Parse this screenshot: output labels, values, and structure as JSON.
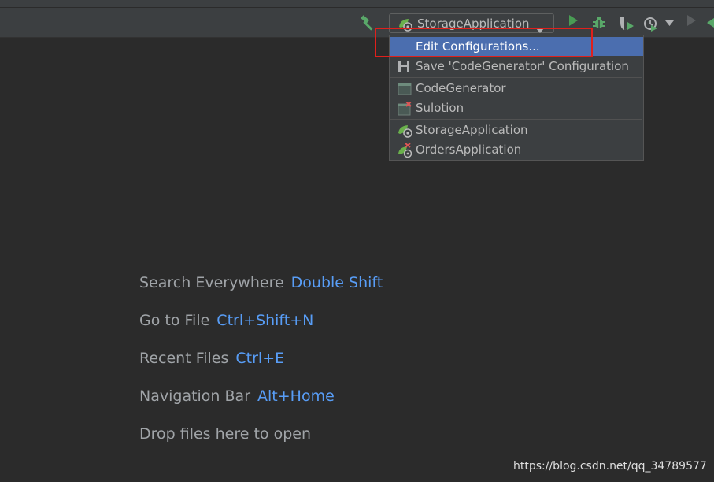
{
  "toolbar": {
    "run_config": {
      "label": "StorageApplication",
      "icon": "spring-boot-icon"
    },
    "icons": [
      "build-hammer-icon",
      "run-icon",
      "debug-bug-icon",
      "coverage-icon",
      "profile-icon",
      "chevron-down-icon",
      "run-disabled-icon"
    ]
  },
  "run_config_menu": {
    "items": [
      {
        "label": "Edit Configurations...",
        "icon": "",
        "selected": true
      },
      {
        "label": "Save 'CodeGenerator' Configuration",
        "icon": "save-icon"
      },
      {
        "label": "CodeGenerator",
        "icon": "application-icon"
      },
      {
        "label": "Sulotion",
        "icon": "application-error-icon"
      },
      {
        "label": "StorageApplication",
        "icon": "spring-boot-icon"
      },
      {
        "label": "OrdersApplication",
        "icon": "spring-boot-error-icon"
      }
    ]
  },
  "empty_editor_hints": [
    {
      "action": "Search Everywhere",
      "shortcut": "Double Shift"
    },
    {
      "action": "Go to File",
      "shortcut": "Ctrl+Shift+N"
    },
    {
      "action": "Recent Files",
      "shortcut": "Ctrl+E"
    },
    {
      "action": "Navigation Bar",
      "shortcut": "Alt+Home"
    },
    {
      "action": "Drop files here to open",
      "shortcut": ""
    }
  ],
  "watermark": "https://blog.csdn.net/qq_34789577",
  "colors": {
    "background": "#2b2b2b",
    "toolbar": "#3c3f41",
    "menu_selection": "#4b6eaf",
    "shortcut_text": "#589df6",
    "annotation_box": "#e0201c",
    "run_green": "#59a869"
  }
}
